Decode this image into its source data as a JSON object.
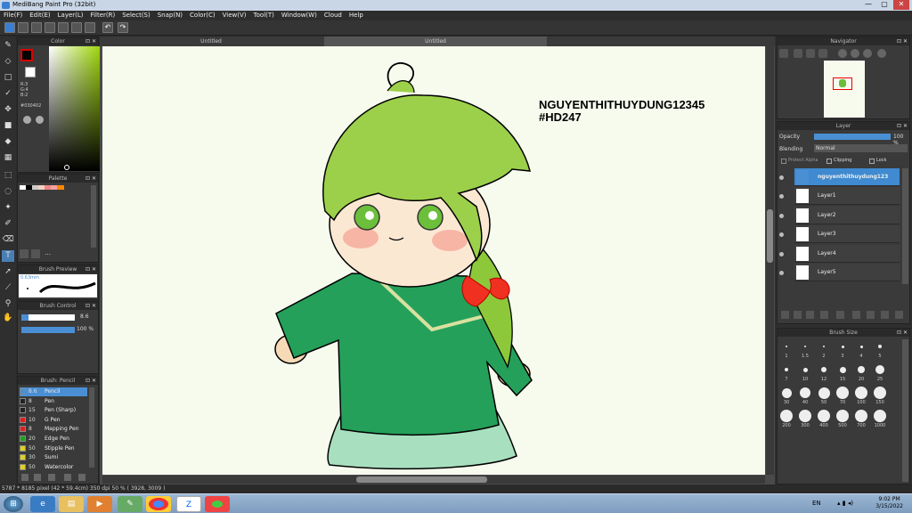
{
  "title": "MediBang Paint Pro (32bit)",
  "window_controls": [
    "—",
    "▢",
    "✕"
  ],
  "menu": [
    "File(F)",
    "Edit(E)",
    "Layer(L)",
    "Filter(R)",
    "Select(S)",
    "Snap(N)",
    "Color(C)",
    "View(V)",
    "Tool(T)",
    "Window(W)",
    "Cloud",
    "Help"
  ],
  "tabs": [
    "Untitled",
    "Untitled"
  ],
  "panels": {
    "color": "Color",
    "palette": "Palette",
    "brush_preview": "Brush Preview",
    "brush_control": "Brush Control",
    "brush": "Brush: Pencil",
    "navigator": "Navigator",
    "layer": "Layer",
    "brush_size": "Brush Size"
  },
  "color": {
    "r": "R:3",
    "g": "G:4",
    "b": "B:2",
    "hex": "#030402"
  },
  "brush_preview": {
    "size": "0.63mm"
  },
  "brush_control": {
    "size": "8.6",
    "opacity": "100 %"
  },
  "brushes": [
    {
      "size": "8.6",
      "name": "Pencil",
      "color": "#4a8fd4"
    },
    {
      "size": "8",
      "name": "Pen",
      "color": "#222222"
    },
    {
      "size": "15",
      "name": "Pen (Sharp)",
      "color": "#222222"
    },
    {
      "size": "10",
      "name": "G Pen",
      "color": "#e02020"
    },
    {
      "size": "8",
      "name": "Mapping Pen",
      "color": "#e02020"
    },
    {
      "size": "20",
      "name": "Edge Pen",
      "color": "#20a020"
    },
    {
      "size": "50",
      "name": "Stipple Pen",
      "color": "#e0d020"
    },
    {
      "size": "30",
      "name": "Sumi",
      "color": "#e0d020"
    },
    {
      "size": "50",
      "name": "Watercolor",
      "color": "#e0d020"
    }
  ],
  "layer": {
    "opacity_label": "Opacity",
    "opacity_value": "100 %",
    "blending_label": "Blending",
    "blending_value": "Normal",
    "protect_alpha": "Protect Alpha",
    "clipping": "Clipping",
    "lock": "Lock",
    "layers": [
      "nguyenthithuydung123",
      "Layer1",
      "Layer2",
      "Layer3",
      "Layer4",
      "Layer5"
    ]
  },
  "brush_sizes": [
    "1",
    "1.5",
    "2",
    "3",
    "4",
    "5",
    "7",
    "10",
    "12",
    "15",
    "20",
    "25",
    "30",
    "40",
    "50",
    "70",
    "100",
    "150",
    "200",
    "300",
    "400",
    "500",
    "700",
    "1000"
  ],
  "watermark": {
    "line1": "NGUYENTHITHUYDUNG12345",
    "line2": "#HD247"
  },
  "status": "5787 * 8185 pixel  (42 * 59.4cm)  350 dpi  50 %  ( 3928, 3009 )",
  "taskbar": {
    "lang": "EN",
    "time": "9:02 PM",
    "date": "3/15/2022"
  }
}
